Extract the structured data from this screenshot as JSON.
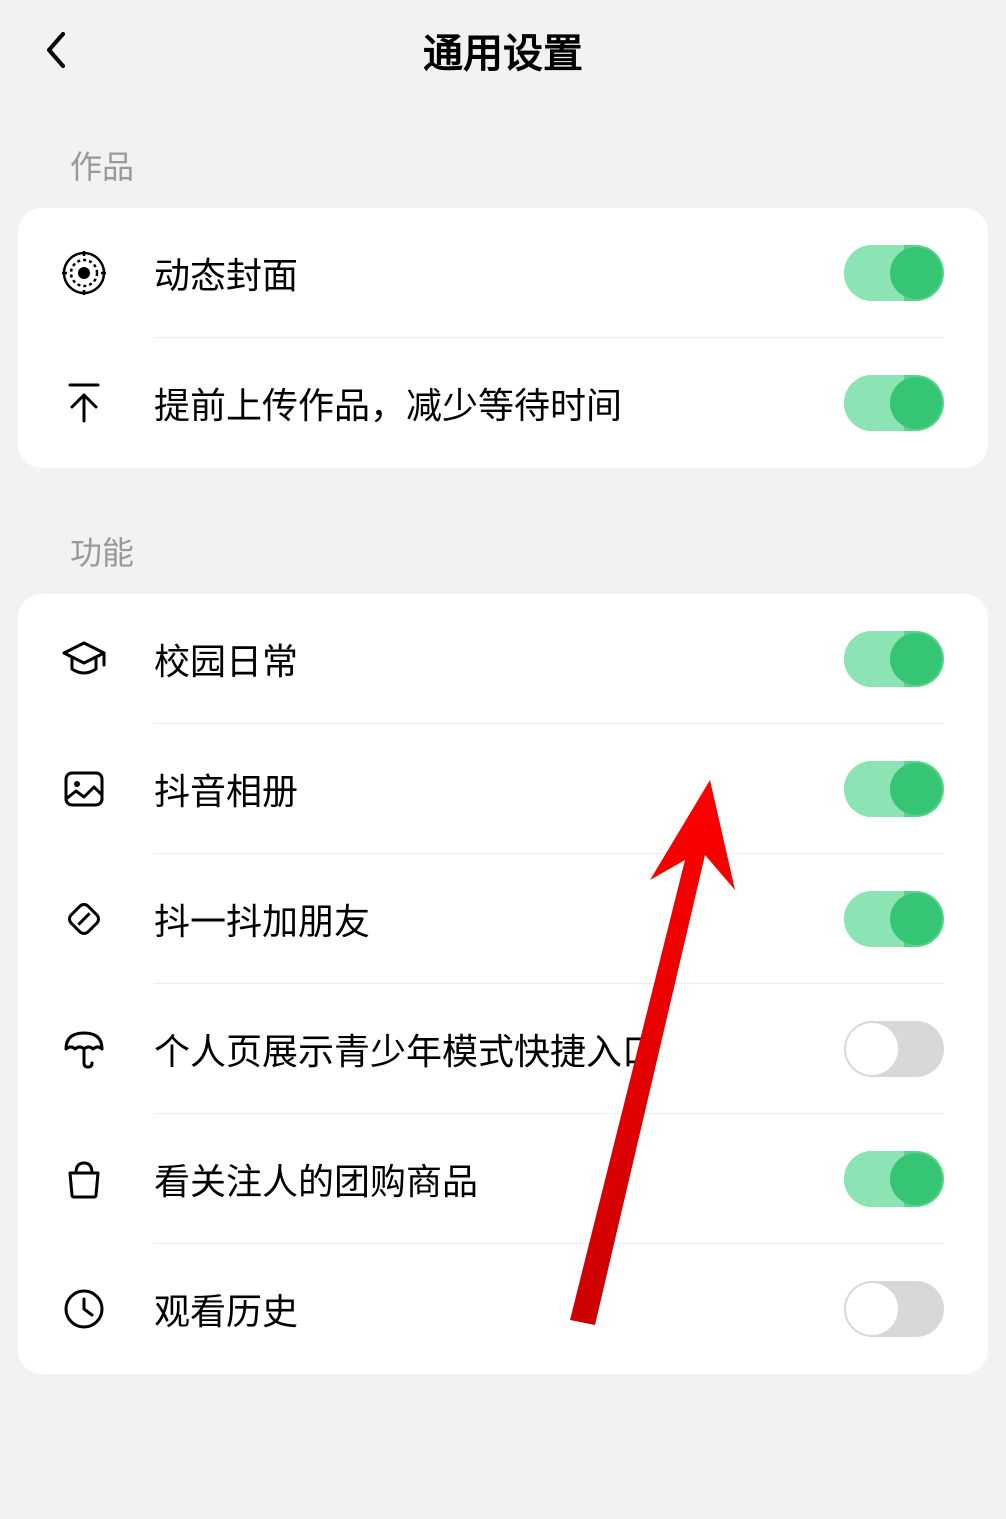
{
  "header": {
    "title": "通用设置"
  },
  "sections": {
    "works": {
      "label": "作品",
      "items": [
        {
          "icon": "target-icon",
          "label": "动态封面",
          "toggle": true
        },
        {
          "icon": "upload-icon",
          "label": "提前上传作品，减少等待时间",
          "toggle": true
        }
      ]
    },
    "features": {
      "label": "功能",
      "items": [
        {
          "icon": "graduation-cap-icon",
          "label": "校园日常",
          "toggle": true
        },
        {
          "icon": "photo-icon",
          "label": "抖音相册",
          "toggle": true
        },
        {
          "icon": "shake-icon",
          "label": "抖一抖加朋友",
          "toggle": true
        },
        {
          "icon": "umbrella-icon",
          "label": "个人页展示青少年模式快捷入口",
          "toggle": false
        },
        {
          "icon": "shopping-bag-icon",
          "label": "看关注人的团购商品",
          "toggle": true
        },
        {
          "icon": "clock-icon",
          "label": "观看历史",
          "toggle": false
        }
      ]
    }
  }
}
